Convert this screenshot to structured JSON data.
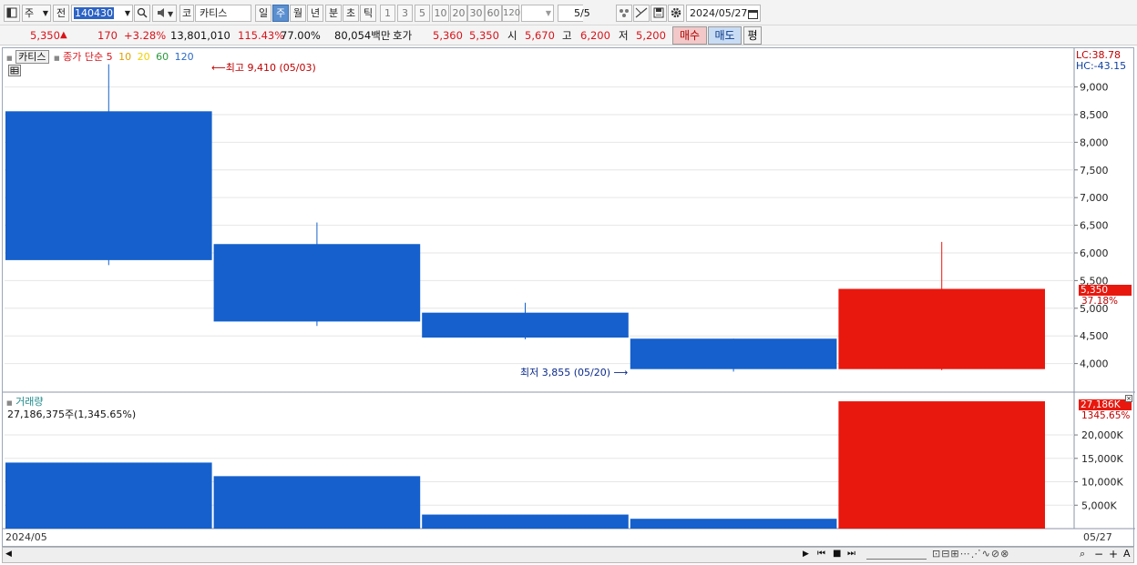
{
  "toolbar": {
    "period_code": "주",
    "compare": "전",
    "stock_code": "140430",
    "market": "코",
    "stock_name": "카티스",
    "periods": [
      "일",
      "주",
      "월",
      "년",
      "분",
      "초",
      "틱"
    ],
    "selected_period": "주",
    "intervals": [
      "1",
      "3",
      "5",
      "10",
      "20",
      "30",
      "60",
      "120"
    ],
    "page": "5/5",
    "date": "2024/05/27"
  },
  "quote": {
    "price": "5,350",
    "arrow": "▲",
    "change": "170",
    "change_pct": "+3.28%",
    "volume": "13,801,010",
    "volume_ratio": "115.43%",
    "turnover": "77.00%",
    "amount": "80,054백만",
    "ask_label": "호가",
    "ask1": "5,360",
    "ask2": "5,350",
    "open_label": "시",
    "open": "5,670",
    "high_label": "고",
    "high": "6,200",
    "low_label": "저",
    "low": "5,200",
    "buy_label": "매수",
    "sell_label": "매도",
    "avg_label": "평"
  },
  "legend": {
    "name": "카티스",
    "ma_title": "종가 단순",
    "ma_periods": [
      "5",
      "10",
      "20",
      "60",
      "120"
    ],
    "ma_colors": [
      "#d8141a",
      "#e0a000",
      "#f0d000",
      "#2a9a3a",
      "#2a6ac8"
    ]
  },
  "annotations": {
    "high": "최고 9,410 (05/03)",
    "low": "최저 3,855 (05/20)"
  },
  "price_axis": {
    "lc": "LC:38.78",
    "hc": "HC:-43.15",
    "current": "5,350",
    "current_pct": "37.18%"
  },
  "volume_panel": {
    "title": "거래량",
    "value": "27,186,375주(1,345.65%)",
    "current": "27,186K",
    "current_pct": "1345.65%"
  },
  "x_axis": {
    "left": "2024/05",
    "right": "05/27"
  },
  "colors": {
    "up": "#e8180e",
    "down": "#1560cc",
    "accent": "#2c63c4"
  },
  "chart_data": [
    {
      "type": "candlestick",
      "ylim": [
        3500,
        9700
      ],
      "yticks": [
        "4,000",
        "4,500",
        "5,000",
        "5,500",
        "6,000",
        "6,500",
        "7,000",
        "7,500",
        "8,000",
        "8,500",
        "9,000"
      ],
      "candles": [
        {
          "open": 8560,
          "close": 5870,
          "high": 9410,
          "low": 5780
        },
        {
          "open": 6160,
          "close": 4760,
          "high": 6550,
          "low": 4680
        },
        {
          "open": 4920,
          "close": 4470,
          "high": 5100,
          "low": 4440
        },
        {
          "open": 4450,
          "close": 3900,
          "high": 4450,
          "low": 3855
        },
        {
          "open": 3900,
          "close": 5350,
          "high": 6200,
          "low": 3880
        }
      ]
    },
    {
      "type": "bar",
      "ylim": [
        0,
        27200
      ],
      "yticks": [
        "5,000K",
        "10,000K",
        "15,000K",
        "20,000K"
      ],
      "values": [
        14100,
        11200,
        3000,
        2100,
        27186
      ]
    }
  ]
}
